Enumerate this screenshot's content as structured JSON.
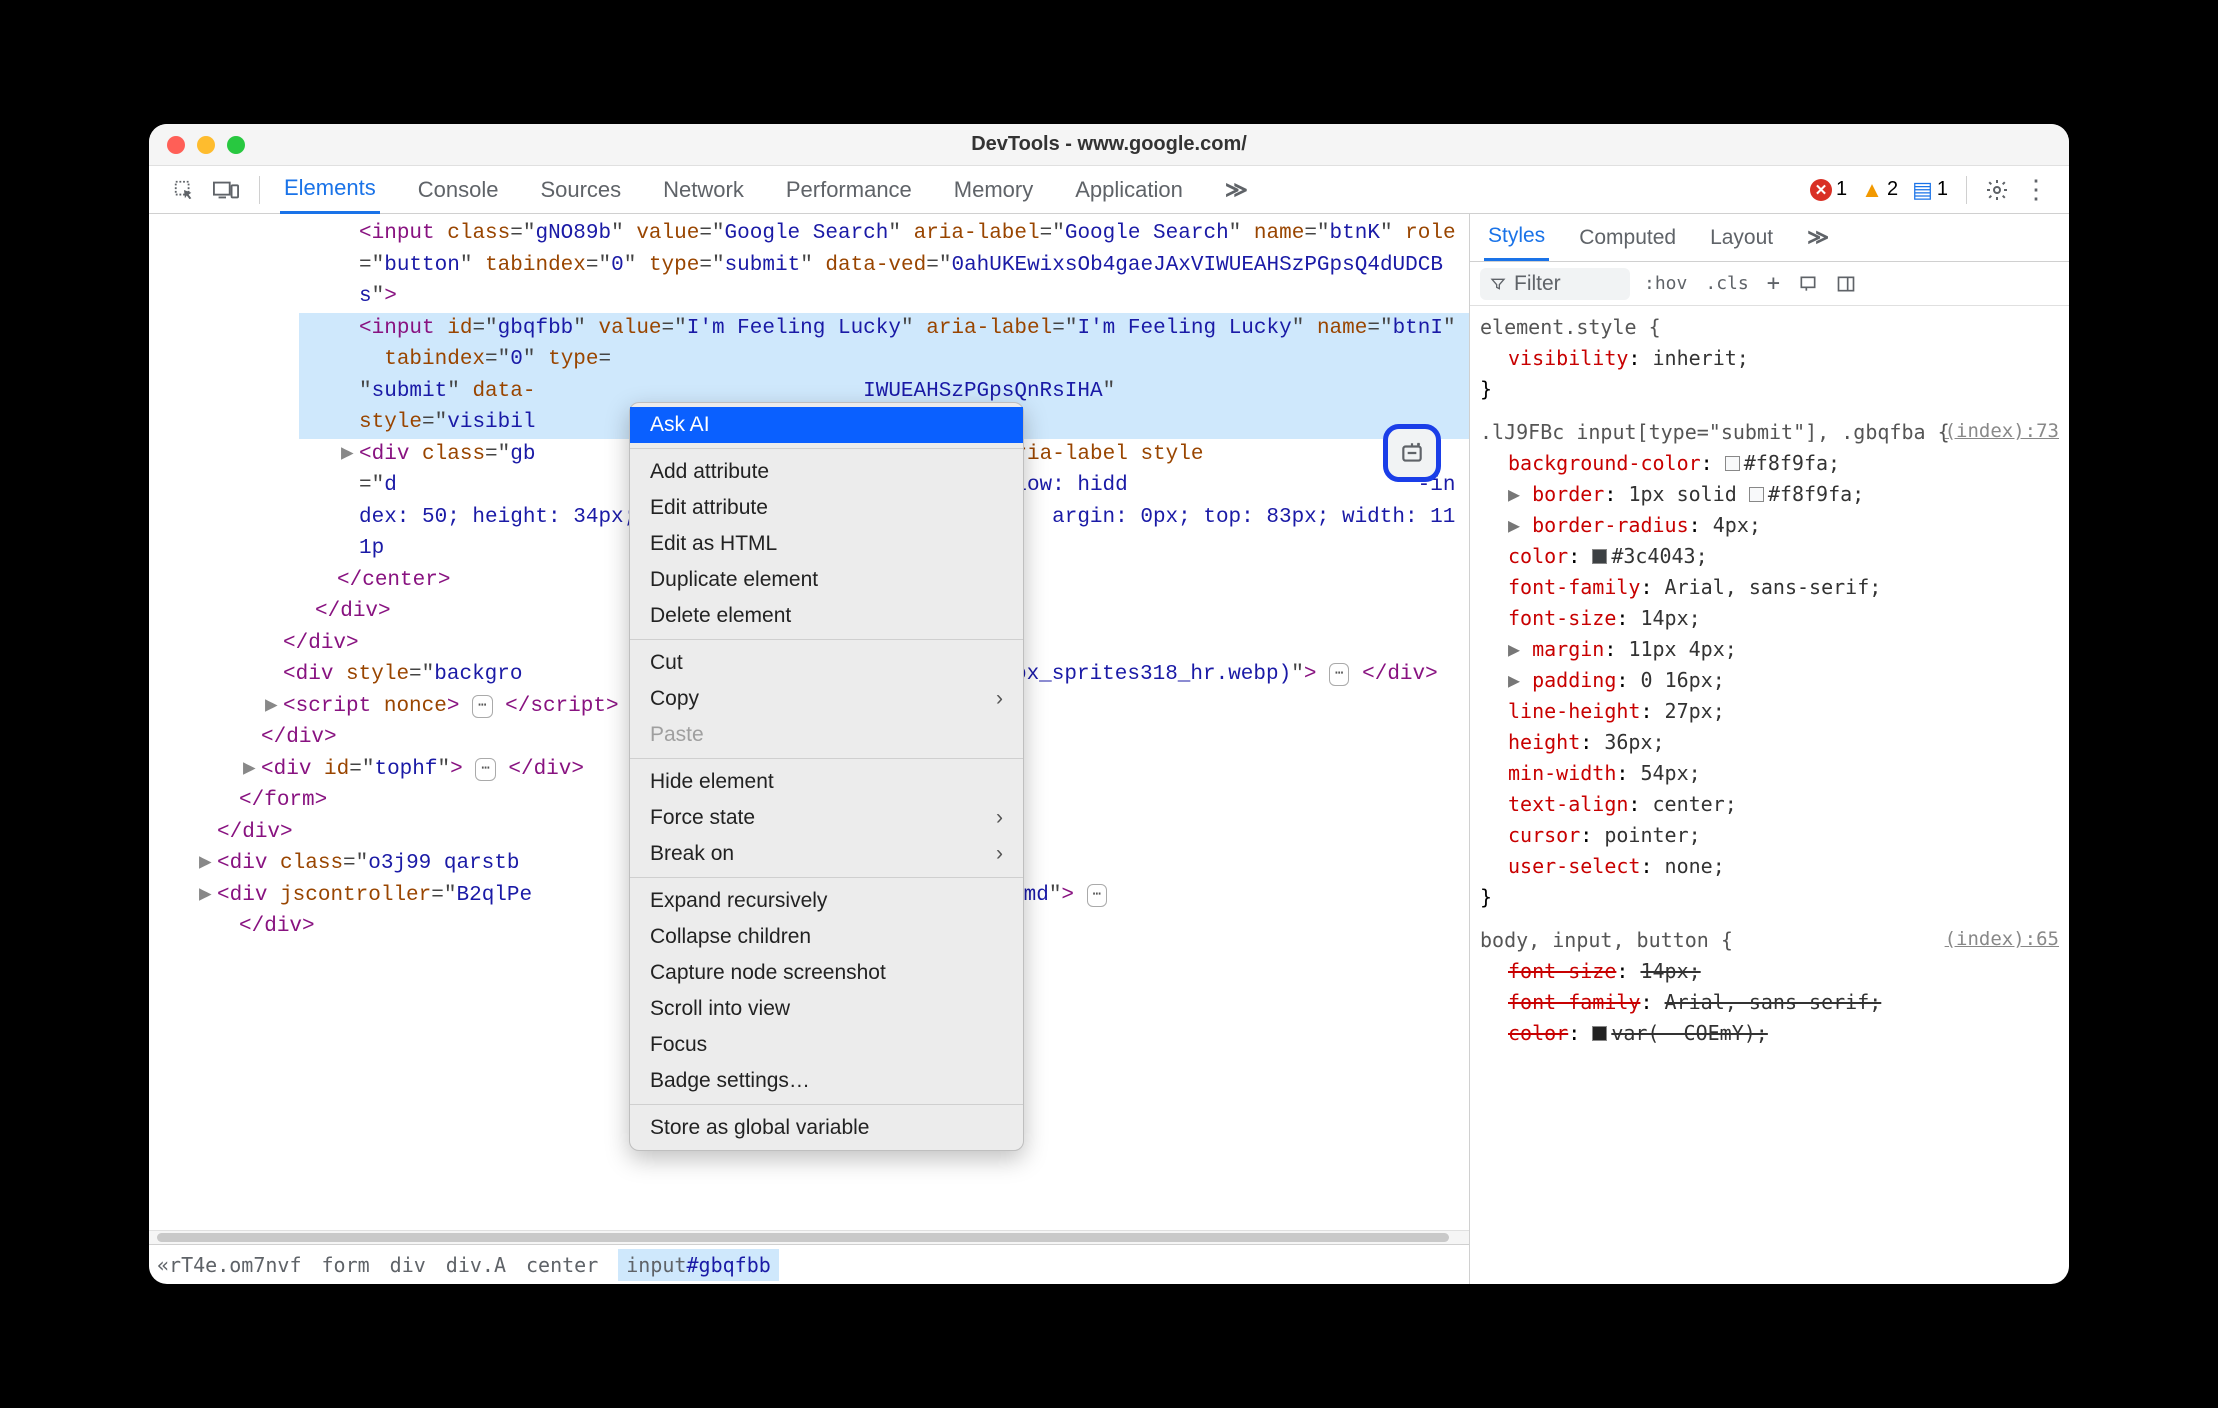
{
  "window": {
    "title": "DevTools - www.google.com/"
  },
  "toolbar": {
    "tabs": [
      "Elements",
      "Console",
      "Sources",
      "Network",
      "Performance",
      "Memory",
      "Application"
    ],
    "overflow": "≫",
    "errors": "1",
    "warnings": "2",
    "messages": "1"
  },
  "dom": {
    "line1": "<input class=\"gNO89b\" value=\"Google Search\" aria-label=\"Google Search\" name=\"btnK\" role=\"button\" tabindex=\"0\" type=\"submit\" data-ved=\"0ahUKEwixsOb4gaeJAxVIWUEAHSzPGpsQ4dUDCBs\">",
    "selected": "<input id=\"gbqfbb\" value=\"I'm Feeling Lucky\" aria-label=\"I'm Feeling Lucky\" name=\"btnI\" role=\"button\" tabindex=\"0\" type=\"submit\" data-ved=\"0ahUKEwixsOb4gaeJAxVIWUEAHSzPGpsQnRsIHA\" style=\"visibility: inherit;\">",
    "line3_open": "<div class=\"gb",
    "line3_mid": "esentation\" aria-label style=\"d",
    "line3_mid2": ": Arial, sans-serif; overflow: hidd",
    "line3_mid3": "-index: 50; height: 34px; position:",
    "line3_mid4": "argin: 0px; top: 83px; width: 111p",
    "center_close": "</center>",
    "div_close": "</div>",
    "line_bg": "<div style=\"backgro",
    "line_bg2": "desktop_searchbox_sprites318_hr.webp)\">",
    "script_open": "<script nonce>",
    "script_close": "</script>",
    "div_tophf": "<div id=\"tophf\">",
    "form_close": "</form>",
    "div_o3j99": "<div class=\"o3j99 qarstb",
    "div_jsc": "<div jscontroller=\"B2qlPe",
    "div_jsc2": "=\"rcuQ6b:npT2md\">"
  },
  "context_menu": {
    "items": [
      {
        "label": "Ask AI",
        "highlight": true
      },
      {
        "sep": true
      },
      {
        "label": "Add attribute"
      },
      {
        "label": "Edit attribute"
      },
      {
        "label": "Edit as HTML"
      },
      {
        "label": "Duplicate element"
      },
      {
        "label": "Delete element"
      },
      {
        "sep": true
      },
      {
        "label": "Cut"
      },
      {
        "label": "Copy",
        "submenu": true
      },
      {
        "label": "Paste",
        "disabled": true
      },
      {
        "sep": true
      },
      {
        "label": "Hide element"
      },
      {
        "label": "Force state",
        "submenu": true
      },
      {
        "label": "Break on",
        "submenu": true
      },
      {
        "sep": true
      },
      {
        "label": "Expand recursively"
      },
      {
        "label": "Collapse children"
      },
      {
        "label": "Capture node screenshot"
      },
      {
        "label": "Scroll into view"
      },
      {
        "label": "Focus"
      },
      {
        "label": "Badge settings…"
      },
      {
        "sep": true
      },
      {
        "label": "Store as global variable"
      }
    ]
  },
  "breadcrumb": [
    "«rT4e.om7nvf",
    "form",
    "div",
    "div.A",
    "center",
    "input#gbqfbb"
  ],
  "styles": {
    "tabs": [
      "Styles",
      "Computed",
      "Layout"
    ],
    "overflow": "≫",
    "filter_placeholder": "Filter",
    "hov": ":hov",
    "cls": ".cls",
    "rules": [
      {
        "selector": "element.style {",
        "src": "",
        "props": [
          {
            "name": "visibility",
            "value": "inherit;"
          }
        ],
        "close": "}"
      },
      {
        "selector": ".lJ9FBc input[type=\"submit\"], .gbqfba {",
        "src": "(index):73",
        "props": [
          {
            "name": "background-color",
            "value": "#f8f9fa;",
            "swatch": "#f8f9fa"
          },
          {
            "name": "border",
            "value": "1px solid",
            "swatch2": "#f8f9fa",
            "value2": "#f8f9fa;",
            "expand": true
          },
          {
            "name": "border-radius",
            "value": "4px;",
            "expand": true
          },
          {
            "name": "color",
            "value": "#3c4043;",
            "swatch": "#3c4043"
          },
          {
            "name": "font-family",
            "value": "Arial, sans-serif;"
          },
          {
            "name": "font-size",
            "value": "14px;"
          },
          {
            "name": "margin",
            "value": "11px 4px;",
            "expand": true
          },
          {
            "name": "padding",
            "value": "0 16px;",
            "expand": true
          },
          {
            "name": "line-height",
            "value": "27px;"
          },
          {
            "name": "height",
            "value": "36px;"
          },
          {
            "name": "min-width",
            "value": "54px;"
          },
          {
            "name": "text-align",
            "value": "center;"
          },
          {
            "name": "cursor",
            "value": "pointer;"
          },
          {
            "name": "user-select",
            "value": "none;"
          }
        ],
        "close": "}"
      },
      {
        "selector": "body, input, button {",
        "src": "(index):65",
        "props": [
          {
            "name": "font-size",
            "value": "14px;",
            "strike": true
          },
          {
            "name": "font-family",
            "value": "Arial, sans-serif;",
            "strike": true
          },
          {
            "name": "color",
            "value": "var(--COEmY);",
            "strike": true,
            "swatch": "#222"
          }
        ]
      }
    ]
  }
}
